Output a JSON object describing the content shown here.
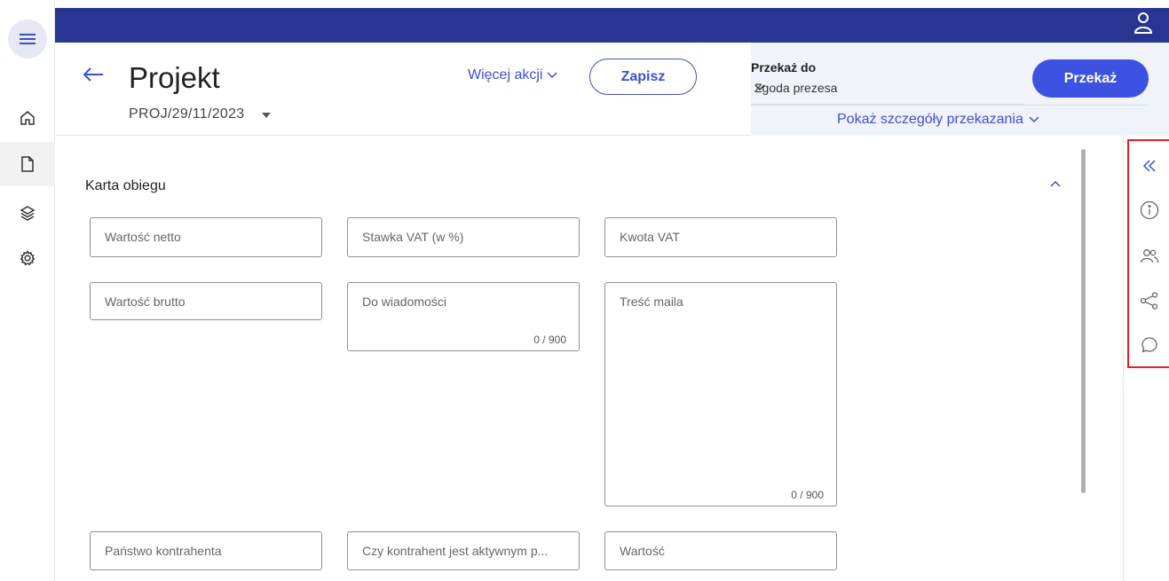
{
  "sidebar": {
    "menu_icon": "hamburger-icon",
    "items": [
      {
        "icon": "home-icon"
      },
      {
        "icon": "document-icon",
        "active": true
      },
      {
        "icon": "layers-icon"
      },
      {
        "icon": "gear-icon"
      }
    ]
  },
  "topbar": {
    "color": "#283593",
    "user_icon": "user-icon"
  },
  "header": {
    "title": "Projekt",
    "doc_number": "PROJ/29/11/2023",
    "more_actions": "Więcej akcji",
    "save": "Zapisz"
  },
  "handover": {
    "label": "Przekaż do",
    "selected": "Zgoda prezesa",
    "button": "Przekaż",
    "details_link": "Pokaż szczegóły przekazania"
  },
  "section": {
    "title": "Karta obiegu",
    "fields": {
      "net_value": "Wartość netto",
      "vat_rate": "Stawka VAT (w %)",
      "vat_amount": "Kwota VAT",
      "gross_value": "Wartość brutto",
      "notify": "Do wiadomości",
      "notify_counter": "0 / 900",
      "mail_body": "Treść maila",
      "mail_counter": "0 / 900",
      "contractor_country": "Państwo kontrahenta",
      "contractor_active": "Czy kontrahent jest aktywnym p...",
      "value": "Wartość"
    }
  },
  "right_rail": {
    "icons": [
      "double-chevron-left-icon",
      "info-icon",
      "users-icon",
      "share-icon",
      "comment-icon"
    ]
  },
  "colors": {
    "accent": "#3d4fd1",
    "primary_button": "#3d52e0",
    "highlight_box": "#e12027"
  }
}
